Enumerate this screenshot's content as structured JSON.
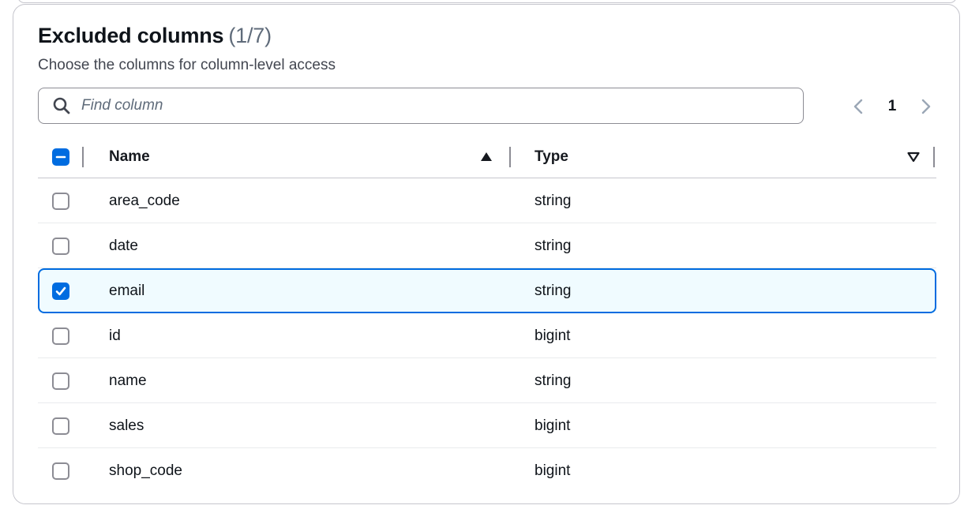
{
  "header": {
    "title": "Excluded columns",
    "count": "(1/7)",
    "description": "Choose the columns for column-level access"
  },
  "search": {
    "placeholder": "Find column",
    "value": ""
  },
  "pagination": {
    "current_page": "1"
  },
  "table": {
    "columns": [
      {
        "label": "Name",
        "sort": "ascending"
      },
      {
        "label": "Type",
        "sort": "sortable"
      }
    ],
    "select_all_state": "indeterminate",
    "rows": [
      {
        "name": "area_code",
        "type": "string",
        "selected": false
      },
      {
        "name": "date",
        "type": "string",
        "selected": false
      },
      {
        "name": "email",
        "type": "string",
        "selected": true
      },
      {
        "name": "id",
        "type": "bigint",
        "selected": false
      },
      {
        "name": "name",
        "type": "string",
        "selected": false
      },
      {
        "name": "sales",
        "type": "bigint",
        "selected": false
      },
      {
        "name": "shop_code",
        "type": "bigint",
        "selected": false
      }
    ]
  },
  "colors": {
    "accent": "#006ce0",
    "selected_row_bg": "#f0fbff",
    "border": "#c6c6cd"
  },
  "icons": {
    "search": "search-icon",
    "prev": "chevron-left-icon",
    "next": "chevron-right-icon",
    "sort_asc": "sort-ascending-icon",
    "sort_none": "sort-caret-down-icon",
    "check": "checkmark-icon",
    "indeterminate": "minus-icon"
  }
}
